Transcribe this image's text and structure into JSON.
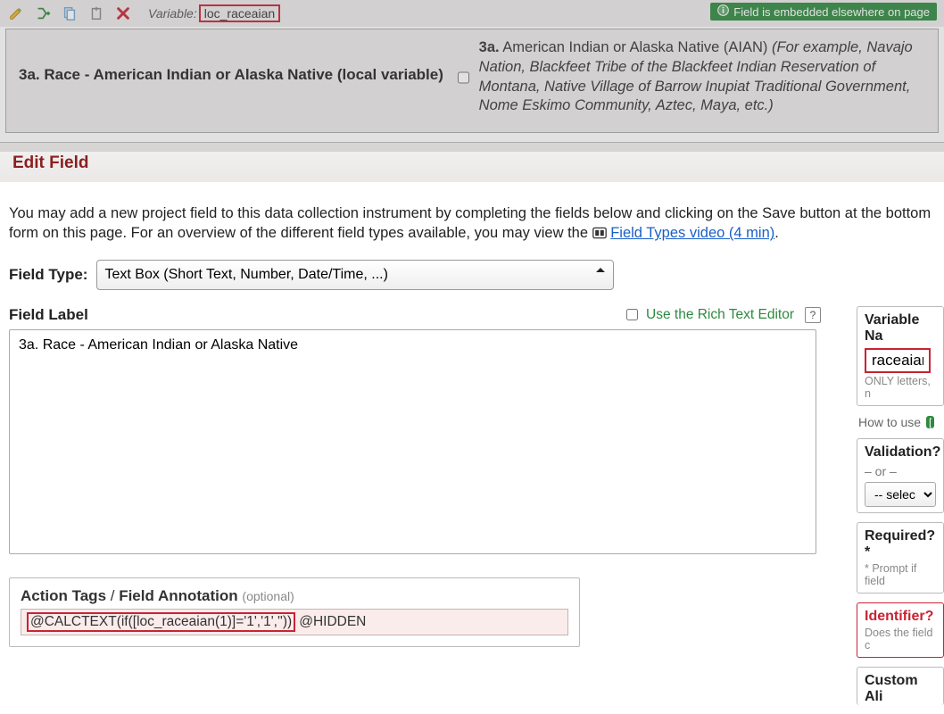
{
  "toolbar": {
    "variable_prefix": "Variable:",
    "variable_name": "loc_raceaian",
    "embed_badge": "Field is embedded elsewhere on page"
  },
  "preview": {
    "left_label": "3a. Race - American Indian or Alaska Native (local variable)",
    "right_bold": "3a.",
    "right_normal": " American Indian or Alaska Native (AIAN) ",
    "right_italic": "(For example, Navajo Nation, Blackfeet Tribe of the Blackfeet Indian Reservation of Montana, Native Village of Barrow Inupiat Traditional Government, Nome Eskimo Community, Aztec, Maya, etc.)"
  },
  "modal": {
    "title": "Edit Field",
    "intro_a": "You may add a new project field to this data collection instrument by completing the fields below and clicking on the Save button at the bottom form on this page. For an overview of the different field types available, you may view the ",
    "intro_link": "Field Types video (4 min)",
    "intro_b": ".",
    "field_type_label": "Field Type:",
    "field_type_value": "Text Box (Short Text, Number, Date/Time, ...)",
    "field_label_header": "Field Label",
    "rte_label": "Use the Rich Text Editor",
    "field_label_value": "3a. Race - American Indian or Alaska Native",
    "action_tags_label_a": "Action Tags",
    "action_tags_label_b": "Field Annotation",
    "action_tags_opt": "(optional)",
    "calc_highlight": "@CALCTEXT(if([loc_raceaian(1)]='1','1',''))",
    "calc_rest": " @HIDDEN"
  },
  "right": {
    "varname_header": "Variable Na",
    "varname_value": "raceaian",
    "varname_hint": "ONLY letters, n",
    "howto": "How to use",
    "validation_header": "Validation?",
    "or": "– or –",
    "select_placeholder": "-- select on",
    "required_header": "Required?*",
    "required_hint": "* Prompt if field",
    "identifier_header": "Identifier?",
    "identifier_hint": "Does the field c",
    "customali_header": "Custom Ali"
  }
}
